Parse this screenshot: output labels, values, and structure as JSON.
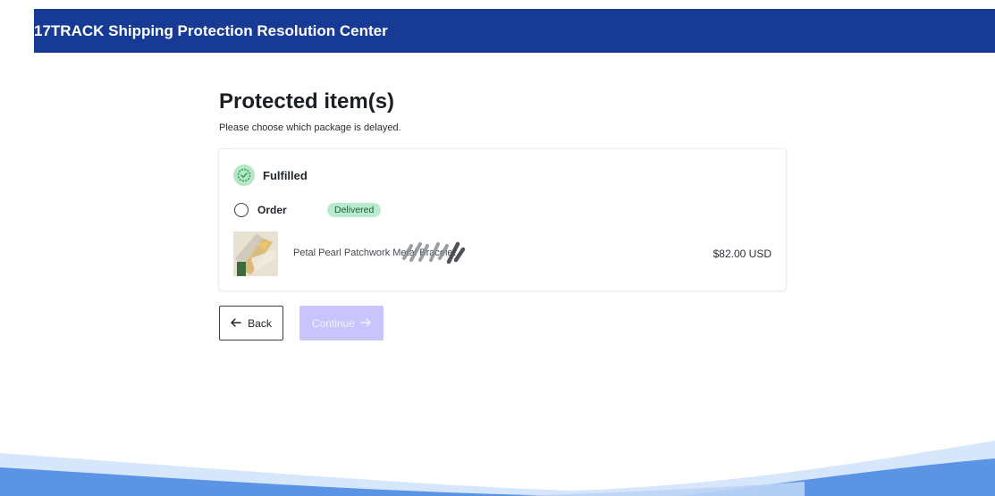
{
  "header": {
    "title": "17TRACK Shipping Protection Resolution Center"
  },
  "page": {
    "title": "Protected item(s)",
    "subtitle": "Please choose which package is delayed."
  },
  "shipment": {
    "status_icon": "check-badge-icon",
    "status_label": "Fulfilled",
    "order_label": "Order",
    "order_badge": "Delivered",
    "item": {
      "name": "Petal Pearl Patchwork Metal Bracelet",
      "price": "$82.00 USD"
    }
  },
  "actions": {
    "back_label": "Back",
    "continue_label": "Continue"
  },
  "colors": {
    "header_bg": "#173b94",
    "badge_bg": "#b8ebcd",
    "continue_disabled_bg": "#c9c4fb",
    "wave_light": "#d6e6fb",
    "wave_dark": "#5b94e4"
  }
}
